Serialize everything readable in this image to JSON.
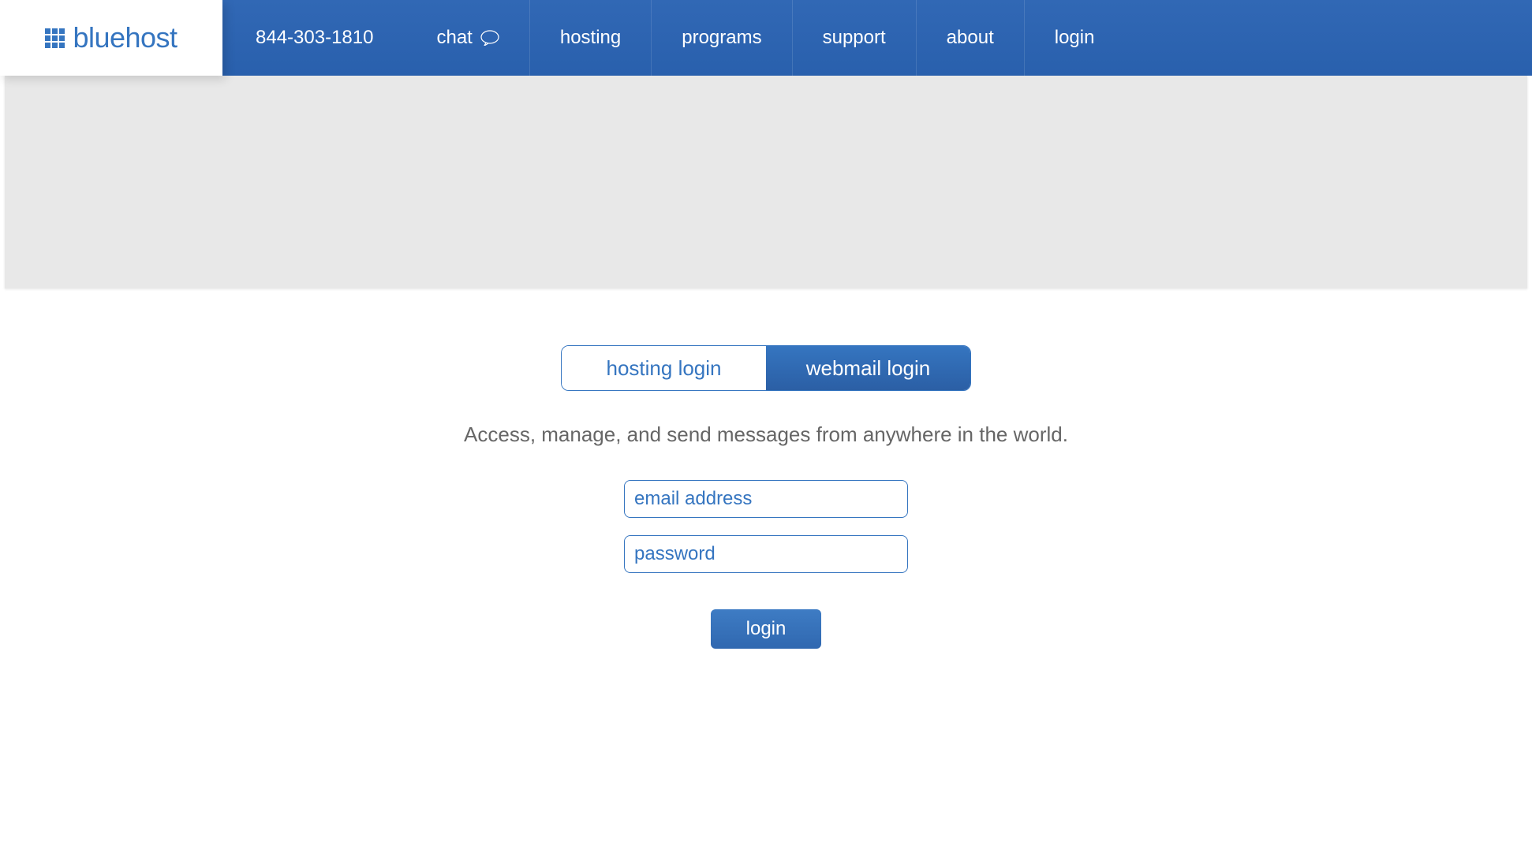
{
  "header": {
    "logo_text": "bluehost",
    "phone": "844-303-1810",
    "nav": {
      "chat": "chat",
      "hosting": "hosting",
      "programs": "programs",
      "support": "support",
      "about": "about",
      "login": "login"
    }
  },
  "login": {
    "tabs": {
      "hosting": "hosting login",
      "webmail": "webmail login"
    },
    "subtitle": "Access, manage, and send messages from anywhere in the world.",
    "email_placeholder": "email address",
    "password_placeholder": "password",
    "button_label": "login"
  },
  "colors": {
    "brand": "#3575c0",
    "header_gradient_top": "#3168b5",
    "header_gradient_bottom": "#2960ad",
    "banner_bg": "#e8e8e8"
  }
}
